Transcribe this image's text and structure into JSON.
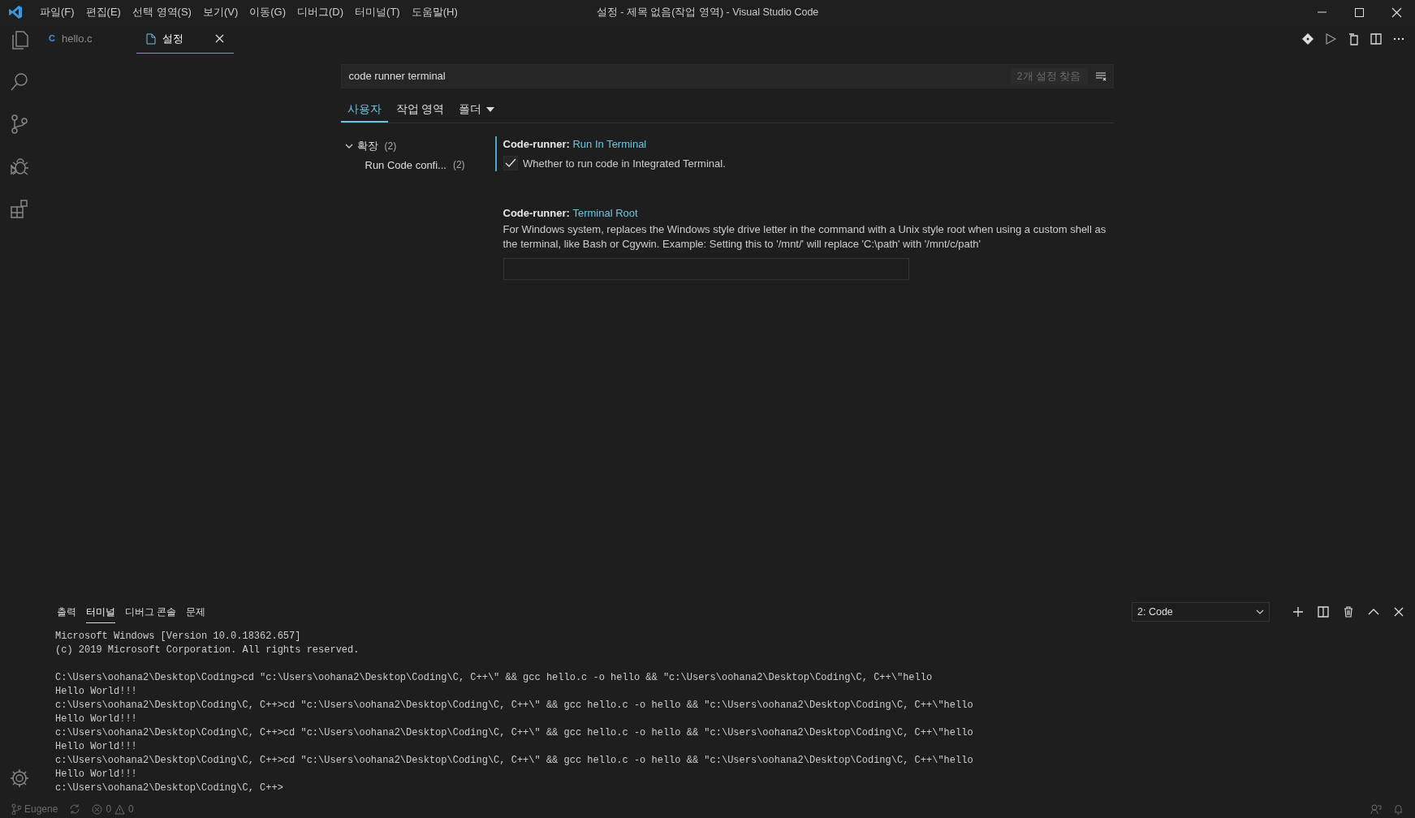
{
  "menu": [
    "파일(F)",
    "편집(E)",
    "선택 영역(S)",
    "보기(V)",
    "이동(G)",
    "디버그(D)",
    "터미널(T)",
    "도움말(H)"
  ],
  "window_title": "설정 - 제목 없음(작업 영역) - Visual Studio Code",
  "editor_tabs": [
    {
      "label": "hello.c",
      "kind": "c-file",
      "icon_text": "C",
      "selected": false
    },
    {
      "label": "설정",
      "kind": "settings",
      "selected": true
    }
  ],
  "settings": {
    "search": {
      "value": "code runner terminal",
      "result_count": "2개 설정 찾음"
    },
    "scopes": [
      {
        "label": "사용자",
        "selected": true
      },
      {
        "label": "작업 영역",
        "selected": false
      },
      {
        "label": "폴더",
        "selected": false,
        "kind": "dropdown"
      }
    ],
    "toc": [
      {
        "label": "확장",
        "count": "(2)",
        "expanded": true,
        "children": [
          {
            "label": "Run Code confi...",
            "count": "(2)"
          }
        ]
      }
    ],
    "items": [
      {
        "kind": "checkbox",
        "category": "Code-runner:",
        "name": "Run In Terminal",
        "description": "Whether to run code in Integrated Terminal.",
        "checked": true,
        "focused": true
      },
      {
        "kind": "text",
        "category": "Code-runner:",
        "name": "Terminal Root",
        "description": "For Windows system, replaces the Windows style drive letter in the command with a Unix style root when using a custom shell as the terminal, like Bash or Cgywin. Example: Setting this to '/mnt/' will replace 'C:\\path' with '/mnt/c/path'",
        "focused": false
      }
    ]
  },
  "panel": {
    "tabs": [
      {
        "label": "출력",
        "selected": false
      },
      {
        "label": "터미널",
        "selected": true
      },
      {
        "label": "디버그 콘솔",
        "selected": false
      },
      {
        "label": "문제",
        "selected": false
      }
    ],
    "terminal_select": "2: Code",
    "terminal_blocks": [
      [
        "Microsoft Windows [Version 10.0.18362.657]",
        "(c) 2019 Microsoft Corporation. All rights reserved."
      ],
      [
        "C:\\Users\\oohana2\\Desktop\\Coding>cd \"c:\\Users\\oohana2\\Desktop\\Coding\\C, C++\\\" && gcc hello.c -o hello && \"c:\\Users\\oohana2\\Desktop\\Coding\\C, C++\\\"hello",
        "Hello World!!!",
        "c:\\Users\\oohana2\\Desktop\\Coding\\C, C++>cd \"c:\\Users\\oohana2\\Desktop\\Coding\\C, C++\\\" && gcc hello.c -o hello && \"c:\\Users\\oohana2\\Desktop\\Coding\\C, C++\\\"hello",
        "Hello World!!!",
        "c:\\Users\\oohana2\\Desktop\\Coding\\C, C++>cd \"c:\\Users\\oohana2\\Desktop\\Coding\\C, C++\\\" && gcc hello.c -o hello && \"c:\\Users\\oohana2\\Desktop\\Coding\\C, C++\\\"hello",
        "Hello World!!!",
        "c:\\Users\\oohana2\\Desktop\\Coding\\C, C++>cd \"c:\\Users\\oohana2\\Desktop\\Coding\\C, C++\\\" && gcc hello.c -o hello && \"c:\\Users\\oohana2\\Desktop\\Coding\\C, C++\\\"hello",
        "Hello World!!!",
        "c:\\Users\\oohana2\\Desktop\\Coding\\C, C++>"
      ]
    ]
  },
  "status_bar": {
    "branch": "Eugene",
    "errors": "0",
    "warnings": "0"
  }
}
